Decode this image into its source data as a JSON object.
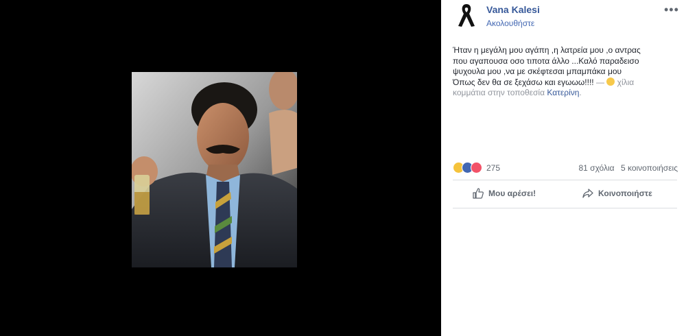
{
  "post": {
    "author": "Vana Kalesi",
    "follow_label": "Ακολουθήστε",
    "text_lines": [
      "Ήταν η μεγάλη μου αγάπη ,η λατρεία μου ,ο αντρας",
      "που αγαπουσα οσο τιποτα άλλο ...Καλό παραδεισο",
      "ψυχουλα μου ,να με σκέφτεσαι μπαμπάκα μου",
      "Όπως δεν θα σε ξεχάσω και εγωωω!!!!"
    ],
    "feeling_prefix": "—",
    "feeling_text": "χίλια",
    "feeling_text2": "κομμάτια στην τοποθεσία",
    "location": "Κατερίνη",
    "location_suffix": "."
  },
  "stats": {
    "reactions_count": "275",
    "comments": "81 σχόλια",
    "shares": "5 κοινοποιήσεις"
  },
  "actions": {
    "like": "Μου αρέσει!",
    "share": "Κοινοποιήστε"
  },
  "icons": {
    "avatar": "black-ribbon-icon",
    "more": "more-options-icon",
    "like": "thumbs-up-icon",
    "share": "share-arrow-icon"
  },
  "colors": {
    "link": "#365899",
    "like_reaction": "#4267b2",
    "love_reaction": "#f25268",
    "sad_reaction": "#f5c33b"
  }
}
